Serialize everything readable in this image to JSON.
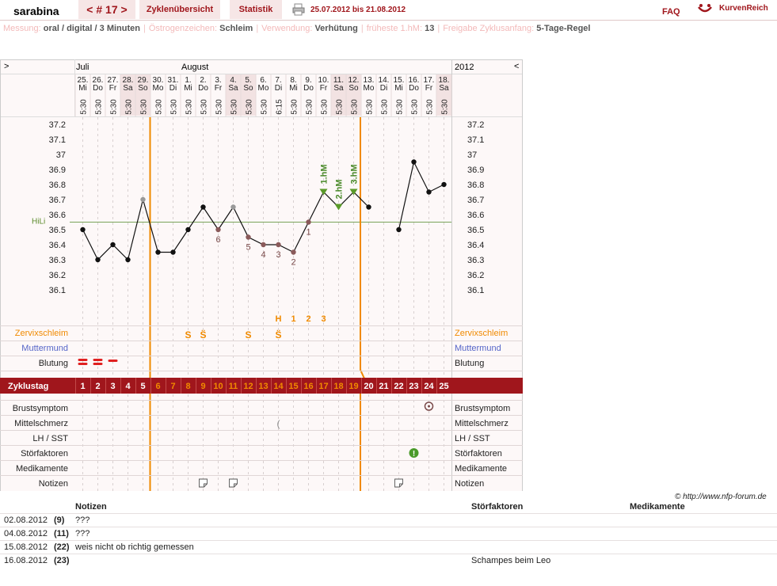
{
  "header": {
    "user": "sarabina",
    "cycle": "< # 17 >",
    "tab_overview": "Zyklenübersicht",
    "tab_stats": "Statistik",
    "date_range": "25.07.2012 bis 21.08.2012",
    "faq": "FAQ",
    "logo": "KurvenReich"
  },
  "meta": [
    {
      "k": "Messung:",
      "v": "oral / digital / 3 Minuten"
    },
    {
      "k": "Östrogenzeichen:",
      "v": "Schleim"
    },
    {
      "k": "Verwendung:",
      "v": "Verhütung"
    },
    {
      "k": "früheste 1.hM:",
      "v": "13"
    },
    {
      "k": "Freigabe Zyklusanfang:",
      "v": "5-Tage-Regel"
    }
  ],
  "nav": {
    "prev": ">",
    "next": "<",
    "year": "2012"
  },
  "months": [
    {
      "label": "Juli",
      "col": 0
    },
    {
      "label": "August",
      "col": 7
    }
  ],
  "days": [
    {
      "d": "25.",
      "w": "Mi",
      "t": "5:30"
    },
    {
      "d": "26.",
      "w": "Do",
      "t": "5:30"
    },
    {
      "d": "27.",
      "w": "Fr",
      "t": "5:30"
    },
    {
      "d": "28.",
      "w": "Sa",
      "t": "5:30"
    },
    {
      "d": "29.",
      "w": "So",
      "t": "5:30"
    },
    {
      "d": "30.",
      "w": "Mo",
      "t": "5:30"
    },
    {
      "d": "31.",
      "w": "Di",
      "t": "5:30"
    },
    {
      "d": "1.",
      "w": "Mi",
      "t": "5:30"
    },
    {
      "d": "2.",
      "w": "Do",
      "t": "5:30"
    },
    {
      "d": "3.",
      "w": "Fr",
      "t": "5:30"
    },
    {
      "d": "4.",
      "w": "Sa",
      "t": "5:30"
    },
    {
      "d": "5.",
      "w": "So",
      "t": "5:30"
    },
    {
      "d": "6.",
      "w": "Mo",
      "t": "5:30"
    },
    {
      "d": "7.",
      "w": "Di",
      "t": "6:15"
    },
    {
      "d": "8.",
      "w": "Mi",
      "t": "5:30"
    },
    {
      "d": "9.",
      "w": "Do",
      "t": "5:30"
    },
    {
      "d": "10.",
      "w": "Fr",
      "t": "5:30"
    },
    {
      "d": "11.",
      "w": "Sa",
      "t": "5:30"
    },
    {
      "d": "12.",
      "w": "So",
      "t": "5:30"
    },
    {
      "d": "13.",
      "w": "Mo",
      "t": "5:30"
    },
    {
      "d": "14.",
      "w": "Di",
      "t": "5:30"
    },
    {
      "d": "15.",
      "w": "Mi",
      "t": "5:30"
    },
    {
      "d": "16.",
      "w": "Do",
      "t": "5:30"
    },
    {
      "d": "17.",
      "w": "Fr",
      "t": "5:30"
    },
    {
      "d": "18.",
      "w": "Sa",
      "t": "5:30"
    }
  ],
  "weekend_cols": [
    3,
    4,
    10,
    11,
    17,
    18,
    24
  ],
  "temp_ticks": [
    "37.2",
    "37.1",
    "37",
    "36.9",
    "36.8",
    "36.7",
    "36.6",
    "36.5",
    "36.4",
    "36.3",
    "36.2",
    "36.1"
  ],
  "hili_label": "HiLi",
  "hili_value": 36.55,
  "temps": [
    36.5,
    36.3,
    36.4,
    36.3,
    36.7,
    36.35,
    36.35,
    36.5,
    36.65,
    36.5,
    36.65,
    36.45,
    36.4,
    36.4,
    36.35,
    36.55,
    36.75,
    36.65,
    36.75,
    36.65,
    null,
    36.5,
    36.95,
    36.75,
    36.8
  ],
  "point_kind": [
    "n",
    "n",
    "n",
    "n",
    "g",
    "n",
    "n",
    "n",
    "n",
    "m",
    "g",
    "m",
    "m",
    "m",
    "m",
    "m",
    "n",
    "n",
    "n",
    "n",
    null,
    "n",
    "n",
    "n",
    "n"
  ],
  "low_labels": [
    {
      "col": 9,
      "t": "6"
    },
    {
      "col": 11,
      "t": "5"
    },
    {
      "col": 12,
      "t": "4"
    },
    {
      "col": 13,
      "t": "3"
    },
    {
      "col": 14,
      "t": "2"
    },
    {
      "col": 15,
      "t": "1"
    }
  ],
  "high_labels": [
    {
      "col": 16,
      "t": "1.hM"
    },
    {
      "col": 17,
      "t": "2.hM"
    },
    {
      "col": 18,
      "t": "3.hM"
    }
  ],
  "mucus_top": [
    {
      "col": 13,
      "t": "H"
    },
    {
      "col": 14,
      "t": "1"
    },
    {
      "col": 15,
      "t": "2"
    },
    {
      "col": 16,
      "t": "3"
    }
  ],
  "mucus": [
    {
      "col": 7,
      "t": "S"
    },
    {
      "col": 8,
      "t": "S̈"
    },
    {
      "col": 11,
      "t": "S"
    },
    {
      "col": 13,
      "t": "S̈"
    }
  ],
  "rows_left": {
    "zervix": "Zervixschleim",
    "mutter": "Muttermund",
    "blutung": "Blutung",
    "zyklustag": "Zyklustag",
    "brust": "Brustsymptom",
    "mittel": "Mittelschmerz",
    "lh": "LH / SST",
    "stoer": "Störfaktoren",
    "medi": "Medikamente",
    "notiz": "Notizen"
  },
  "cycle_days": [
    "1",
    "2",
    "3",
    "4",
    "5",
    "6",
    "7",
    "8",
    "9",
    "10",
    "11",
    "12",
    "13",
    "14",
    "15",
    "16",
    "17",
    "18",
    "19",
    "20",
    "21",
    "22",
    "23",
    "24",
    "25"
  ],
  "copyright": "© http://www.nfp-forum.de",
  "notes_table": {
    "headers": [
      "Notizen",
      "Störfaktoren",
      "Medikamente"
    ],
    "rows": [
      {
        "date": "02.08.2012",
        "day": "(9)",
        "note": "???",
        "stoer": ""
      },
      {
        "date": "04.08.2012",
        "day": "(11)",
        "note": "???",
        "stoer": ""
      },
      {
        "date": "15.08.2012",
        "day": "(22)",
        "note": "weis nicht ob richtig gemessen",
        "stoer": ""
      },
      {
        "date": "16.08.2012",
        "day": "(23)",
        "note": "",
        "stoer": "Schampes beim Leo"
      }
    ]
  },
  "colors": {
    "accent": "#a0161c",
    "orange": "#f08a00",
    "green": "#5a8a2a",
    "blue": "#5565c8",
    "weekend": "#f2e2e2"
  }
}
